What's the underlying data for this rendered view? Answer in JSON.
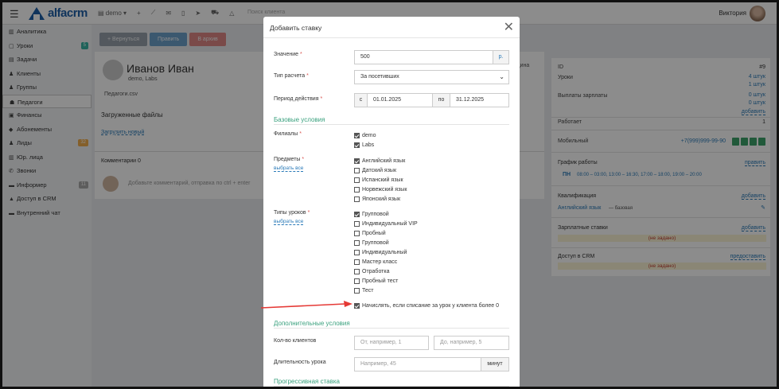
{
  "app": {
    "logo": "alfacrm",
    "search_placeholder": "Поиск клиента",
    "branch": "demo",
    "user": "Виктория"
  },
  "sidebar": {
    "items": [
      {
        "label": "Аналитика",
        "icon": "chart-icon"
      },
      {
        "label": "Уроки",
        "icon": "calendar-icon",
        "badge": "5",
        "badge_color": "#3ab4a5"
      },
      {
        "label": "Задачи",
        "icon": "tasks-icon"
      },
      {
        "label": "Клиенты",
        "icon": "user-icon"
      },
      {
        "label": "Группы",
        "icon": "group-icon"
      },
      {
        "label": "Педагоги",
        "icon": "teacher-icon",
        "active": true
      },
      {
        "label": "Финансы",
        "icon": "money-icon"
      },
      {
        "label": "Абонементы",
        "icon": "tag-icon"
      },
      {
        "label": "Лиды",
        "icon": "leads-icon",
        "badge": "32",
        "badge_color": "#f0ad4e"
      },
      {
        "label": "Юр. лица",
        "icon": "building-icon"
      },
      {
        "label": "Звонки",
        "icon": "phone-icon"
      },
      {
        "label": "Информер",
        "icon": "informer-icon",
        "badge": "11",
        "badge_color": "#aaaaaa"
      },
      {
        "label": "Доступ в CRM",
        "icon": "lock-icon"
      },
      {
        "label": "Внутренний чат",
        "icon": "chat-icon"
      }
    ]
  },
  "actions": {
    "return": "+ Вернуться",
    "edit": "Править",
    "archive": "В архив"
  },
  "profile": {
    "name": "Иванов Иван",
    "branch": "demo, Labs",
    "cv": "Педагоги.csv",
    "files_title": "Загруженные файлы",
    "upload": "Загрузить новый",
    "side_hint": "ощина"
  },
  "comments": {
    "tab": "Комментарии 0",
    "placeholder": "Добавьте комментарий, отправка по ctrl + enter"
  },
  "right": {
    "id_label": "ID",
    "id_value": "#9",
    "lessons_label": "Уроки",
    "lessons_v1": "4 штук",
    "lessons_v2": "1 штук",
    "payouts_label": "Выплаты зарплаты",
    "payouts_v1": "0 штук",
    "payouts_v2": "0 штук",
    "payouts_add": "добавить",
    "works_label": "Работает",
    "works_value": "1",
    "mobile_label": "Мобильный",
    "mobile_value": "+7(999)999-99-90",
    "schedule_label": "График работы",
    "schedule_edit": "править",
    "schedule_day": "ПН",
    "schedule_text": "08:00 – 03:00, 13:00 – 16:30, 17:00 – 18:00, 19:00 – 20:00",
    "qual_label": "Квалификация",
    "qual_add": "добавить",
    "qual_value": "Английский язык",
    "qual_level": "— базовая",
    "salary_label": "Зарплатные ставки",
    "salary_add": "добавить",
    "salary_empty": "(не задано)",
    "crm_label": "Доступ в CRM",
    "crm_give": "предоставить",
    "crm_empty": "(не задано)"
  },
  "modal": {
    "title": "Добавить ставку",
    "value_label": "Значение",
    "value": "500",
    "value_addon": "р.",
    "calc_label": "Тип расчета",
    "calc_value": "За посетивших",
    "period_label": "Период действия",
    "from_label": "с",
    "from": "01.01.2025",
    "to_label": "по",
    "to": "31.12.2025",
    "section_basic": "Базовые условия",
    "branches_label": "Филиалы",
    "branches": [
      {
        "label": "demo",
        "checked": true
      },
      {
        "label": "Labs",
        "checked": true
      }
    ],
    "subjects_label": "Предметы",
    "subjects_pick": "выбрать все",
    "subjects": [
      {
        "label": "Английский язык",
        "checked": true
      },
      {
        "label": "Датский язык",
        "checked": false
      },
      {
        "label": "Испанский язык",
        "checked": false
      },
      {
        "label": "Норвежский язык",
        "checked": false
      },
      {
        "label": "Японский язык",
        "checked": false
      }
    ],
    "types_label": "Типы уроков",
    "types_pick": "выбрать все",
    "types": [
      {
        "label": "Групповой",
        "checked": true
      },
      {
        "label": "Индивидуальный VIP",
        "checked": false
      },
      {
        "label": "Пробный",
        "checked": false
      },
      {
        "label": "Групповой",
        "checked": false
      },
      {
        "label": "Индивидуальный",
        "checked": false
      },
      {
        "label": "Мастер класс",
        "checked": false
      },
      {
        "label": "Отработка",
        "checked": false
      },
      {
        "label": "Пробный тест",
        "checked": false
      },
      {
        "label": "Тест",
        "checked": false
      }
    ],
    "accrue_label": "Начислять, если списание за урок у клиента более 0",
    "section_extra": "Дополнительные условия",
    "clients_label": "Кол-во клиентов",
    "clients_from_ph": "От, например, 1",
    "clients_to_ph": "До, например, 5",
    "duration_label": "Длительность урока",
    "duration_ph": "Например, 45",
    "duration_unit": "минут",
    "section_progressive": "Прогрессивная ставка"
  },
  "colors": {
    "accent": "#2a7ab8",
    "section": "#3aa17e",
    "arrow": "#e53935"
  }
}
